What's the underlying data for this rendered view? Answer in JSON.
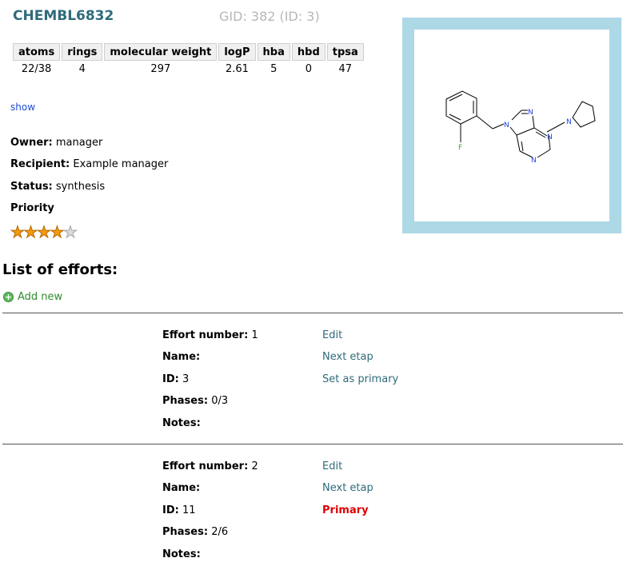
{
  "header": {
    "compound_name": "CHEMBL6832",
    "gid_text": "GID: 382 (ID: 3)"
  },
  "properties": {
    "headers": [
      "atoms",
      "rings",
      "molecular weight",
      "logP",
      "hba",
      "hbd",
      "tpsa"
    ],
    "values": [
      "22/38",
      "4",
      "297",
      "2.61",
      "5",
      "0",
      "47"
    ]
  },
  "show_link": "show",
  "info": {
    "owner_label": "Owner:",
    "owner_value": "manager",
    "recipient_label": "Recipient:",
    "recipient_value": "Example manager",
    "status_label": "Status:",
    "status_value": "synthesis",
    "priority_label": "Priority",
    "priority_value": 4,
    "priority_max": 5
  },
  "molecule": {
    "atom_labels": [
      "F",
      "N",
      "N",
      "N",
      "N",
      "N"
    ]
  },
  "efforts_heading": "List of efforts:",
  "add_new_label": "Add new",
  "colors": {
    "title": "#2f6b7b",
    "frame": "#add8e6",
    "link": "#2f6b7b",
    "primary": "#e00000",
    "add": "#2e8b2e"
  },
  "efforts": [
    {
      "number_label": "Effort number:",
      "number": "1",
      "name_label": "Name:",
      "name": "",
      "id_label": "ID:",
      "id": "3",
      "phases_label": "Phases:",
      "phases": "0/3",
      "notes_label": "Notes:",
      "notes": "",
      "edit": "Edit",
      "next": "Next etap",
      "primary_action": "Set as primary"
    },
    {
      "number_label": "Effort number:",
      "number": "2",
      "name_label": "Name:",
      "name": "",
      "id_label": "ID:",
      "id": "11",
      "phases_label": "Phases:",
      "phases": "2/6",
      "notes_label": "Notes:",
      "notes": "",
      "edit": "Edit",
      "next": "Next etap",
      "primary_status": "Primary"
    }
  ]
}
